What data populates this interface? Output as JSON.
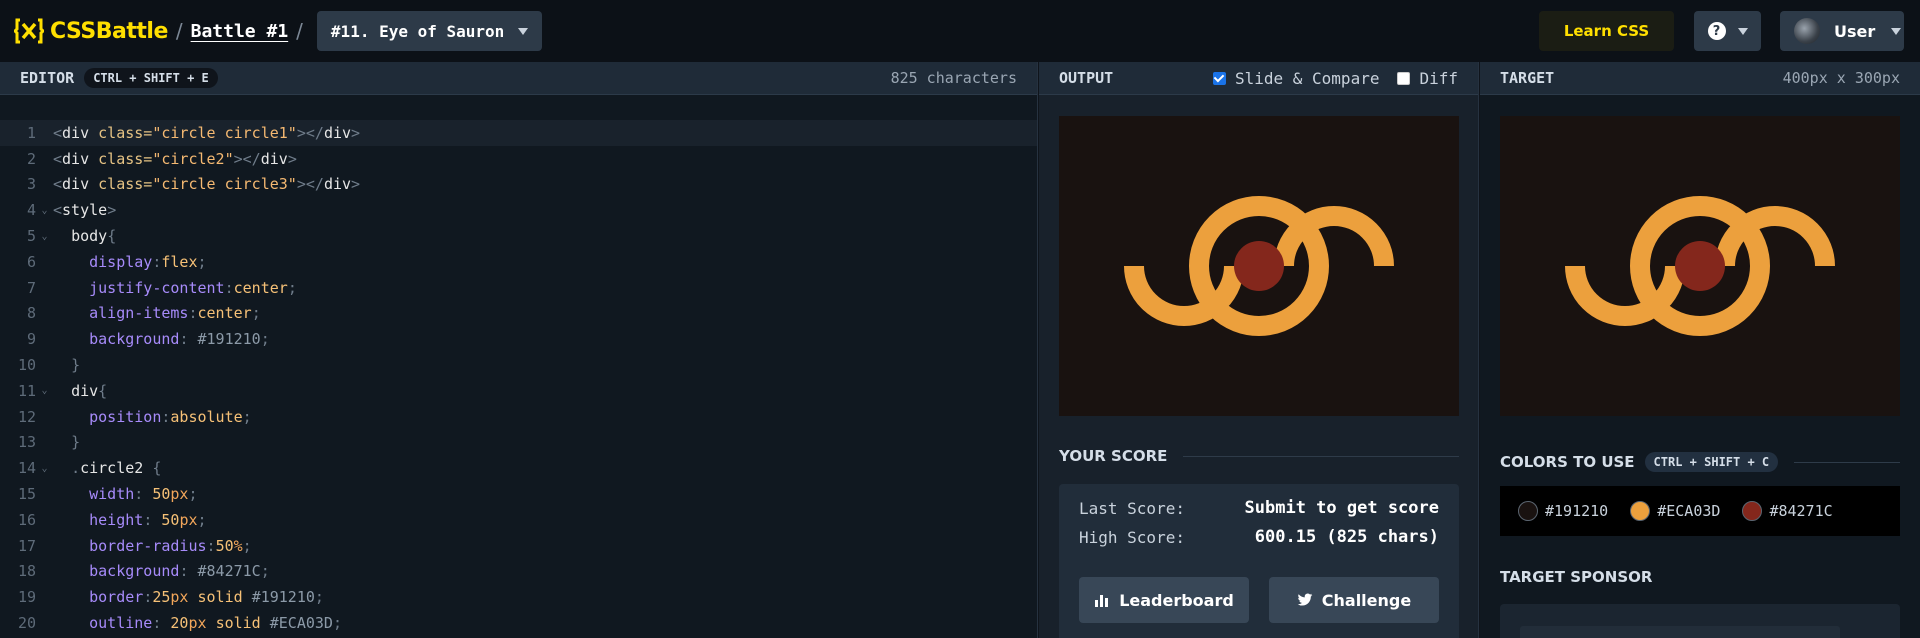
{
  "topbar": {
    "logo_text": "CSSBattle",
    "logo_icon": "css-battle-logo-icon",
    "battle_link": "Battle #1",
    "separator": "/",
    "target_select": "#11. Eye of Sauron",
    "learn_label": "Learn CSS",
    "help_icon": "?",
    "user_label": "User"
  },
  "editor": {
    "title": "EDITOR",
    "shortcut": "CTRL + SHIFT + E",
    "char_count": "825 characters"
  },
  "output": {
    "title": "OUTPUT",
    "slide_compare_label": "Slide & Compare",
    "slide_compare_checked": true,
    "diff_label": "Diff",
    "diff_checked": false
  },
  "score": {
    "title": "YOUR SCORE",
    "last_label": "Last Score:",
    "last_value": "Submit to get score",
    "high_label": "High Score:",
    "high_value": "600.15 (825 chars)",
    "leaderboard_label": "Leaderboard",
    "challenge_label": "Challenge"
  },
  "target": {
    "title": "TARGET",
    "size": "400px x 300px",
    "colors_title": "COLORS TO USE",
    "colors_shortcut": "CTRL + SHIFT + C",
    "colors": [
      "#191210",
      "#ECA03D",
      "#84271C"
    ],
    "sponsor_title": "TARGET SPONSOR"
  },
  "artwork": {
    "background": "#191210",
    "stroke": "#ECA03D",
    "pupil": "#84271C"
  }
}
